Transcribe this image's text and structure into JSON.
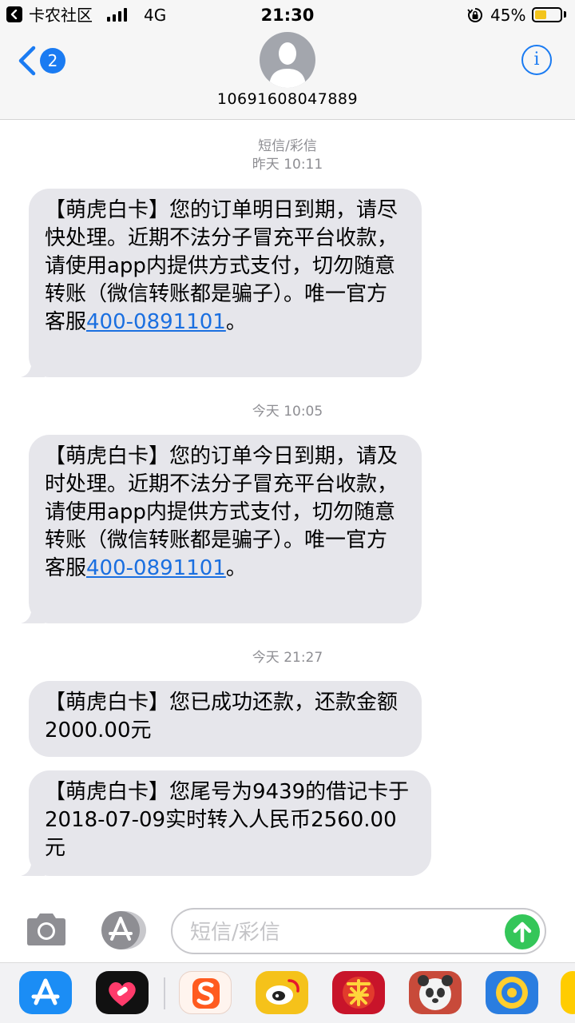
{
  "status_bar": {
    "carrier": "卡农社区",
    "network": "4G",
    "time": "21:30",
    "battery_percent": "45%",
    "battery_level": 0.45,
    "battery_color": "#f3c41c"
  },
  "header": {
    "unread_count": "2",
    "contact": "10691608047889",
    "accent": "#1a7bf2"
  },
  "thread": {
    "service_label": "短信/彩信",
    "groups": [
      {
        "timestamp": "昨天 10:11",
        "messages": [
          {
            "text": "【萌虎白卡】您的订单明日到期，请尽快处理。近期不法分子冒充平台收款，请使用app内提供方式支付，切勿随意转账（微信转账都是骗子）。唯一官方客服",
            "link": "400-0891101",
            "suffix": "。"
          }
        ]
      },
      {
        "timestamp": "今天 10:05",
        "messages": [
          {
            "text": "【萌虎白卡】您的订单今日到期，请及时处理。近期不法分子冒充平台收款，请使用app内提供方式支付，切勿随意转账（微信转账都是骗子）。唯一官方客服",
            "link": "400-0891101",
            "suffix": "。"
          }
        ]
      },
      {
        "timestamp": "今天 21:27",
        "messages": [
          {
            "text": "【萌虎白卡】您已成功还款，还款金额2000.00元"
          },
          {
            "text": "【萌虎白卡】您尾号为9439的借记卡于2018-07-09实时转入人民币2560.00元"
          }
        ]
      }
    ]
  },
  "composer": {
    "placeholder": "短信/彩信",
    "send_color": "#34c659"
  },
  "app_drawer": {
    "apps": [
      "app-store-icon",
      "heart-app-icon",
      "sogou-icon",
      "weibo-icon",
      "game-app-icon",
      "panda-game-icon",
      "circle-app-icon"
    ]
  }
}
